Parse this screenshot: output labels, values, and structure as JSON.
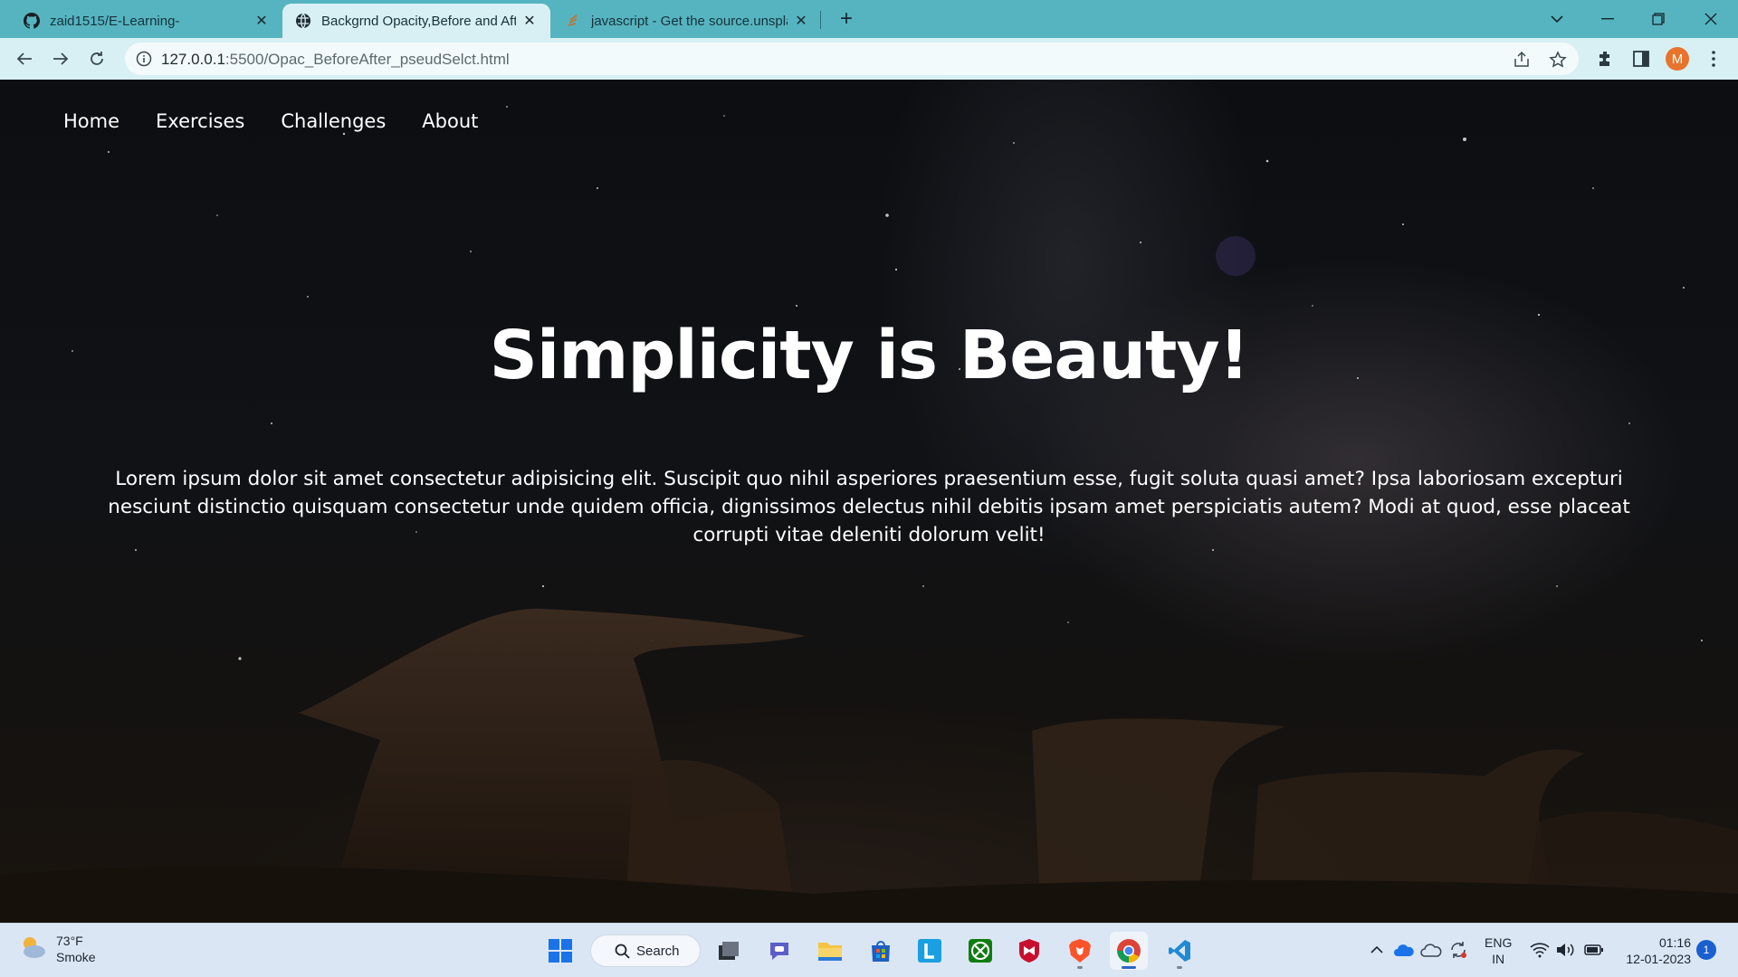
{
  "browser": {
    "tabs": [
      {
        "title": "zaid1515/E-Learning-",
        "icon": "github-icon"
      },
      {
        "title": "Backgrnd Opacity,Before and Aft",
        "icon": "globe-icon"
      },
      {
        "title": "javascript - Get the source.unspla",
        "icon": "stackoverflow-icon"
      }
    ],
    "url_host": "127.0.0.1",
    "url_rest": ":5500/Opac_BeforeAfter_pseudSelct.html",
    "profile_initial": "M"
  },
  "page": {
    "nav": [
      "Home",
      "Exercises",
      "Challenges",
      "About"
    ],
    "title": "Simplicity is Beauty!",
    "paragraph": "Lorem ipsum dolor sit amet consectetur adipisicing elit. Suscipit quo nihil asperiores praesentium esse, fugit soluta quasi amet? Ipsa laboriosam excepturi nesciunt distinctio quisquam consectetur unde quidem officia, dignissimos delectus nihil debitis ipsam amet perspiciatis autem? Modi at quod, esse placeat corrupti vitae deleniti dolorum velit!"
  },
  "taskbar": {
    "weather_temp": "73°F",
    "weather_desc": "Smoke",
    "search_label": "Search",
    "lang_top": "ENG",
    "lang_bottom": "IN",
    "time": "01:16",
    "date": "12-01-2023",
    "notification_count": "1"
  }
}
